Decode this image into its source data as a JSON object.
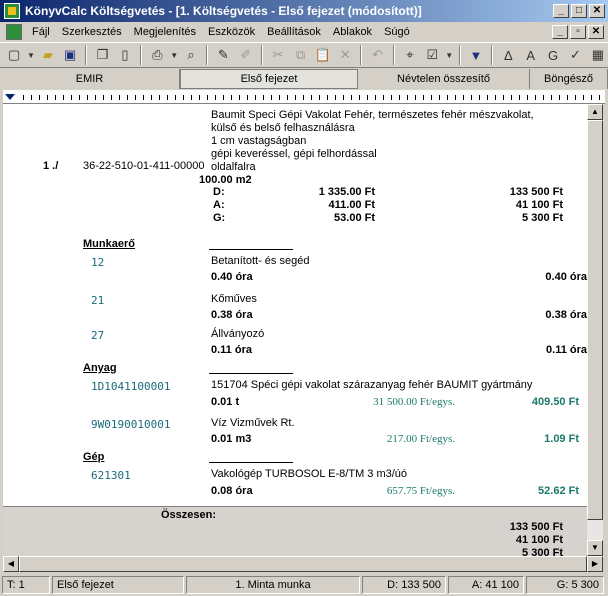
{
  "window": {
    "title": "KönyvCalc Költségvetés - [1. Költségvetés - Első fejezet (módosított)]",
    "buttons": [
      "_",
      "□",
      "✕"
    ]
  },
  "menu": {
    "items": [
      "Fájl",
      "Szerkesztés",
      "Megjelenítés",
      "Eszközök",
      "Beállítások",
      "Ablakok",
      "Súgó"
    ]
  },
  "tabs": [
    "EMIR",
    "Első fejezet",
    "Névtelen összesítő",
    "Böngésző"
  ],
  "item": {
    "number": "1 ./",
    "code": "36-22-510-01-411-00000",
    "description": [
      "Baumit Speci Gépi Vakolat Fehér, természetes fehér mészvakolat,",
      "külső és belső felhasználásra",
      "1 cm vastagságban",
      "gépi keveréssel, gépi felhordással",
      "oldalfalra"
    ],
    "quantity": "100.00 m2",
    "rows": [
      {
        "label": "D:",
        "unit_price": "1 335.00 Ft",
        "total": "133 500 Ft"
      },
      {
        "label": "A:",
        "unit_price": "411.00 Ft",
        "total": "41 100 Ft"
      },
      {
        "label": "G:",
        "unit_price": "53.00 Ft",
        "total": "5 300 Ft"
      }
    ]
  },
  "sections": {
    "labor": {
      "title": "Munkaerő",
      "rows": [
        {
          "code": "12",
          "name": "Betanított- és segéd",
          "qty": "0.40 óra",
          "amount": "0.40 óra"
        },
        {
          "code": "21",
          "name": "Kőműves",
          "qty": "0.38 óra",
          "amount": "0.38 óra"
        },
        {
          "code": "27",
          "name": "Állványozó",
          "qty": "0.11 óra",
          "amount": "0.11 óra"
        }
      ]
    },
    "material": {
      "title": "Anyag",
      "rows": [
        {
          "code": "1D1041100001",
          "name": "151704 Spéci gépi vakolat szárazanyag fehér BAUMIT gyártmány",
          "qty": "0.01 t",
          "price": "31 500.00 Ft/egys.",
          "amount": "409.50 Ft"
        },
        {
          "code": "9W0190010001",
          "name": "Víz Vizművek Rt.",
          "qty": "0.01 m3",
          "price": "217.00 Ft/egys.",
          "amount": "1.09 Ft"
        }
      ]
    },
    "machine": {
      "title": "Gép",
      "rows": [
        {
          "code": "621301",
          "name": "Vakológép TURBOSOL E-8/TM 3 m3/úó",
          "qty": "0.08 óra",
          "price": "657.75 Ft/egys.",
          "amount": "52.62 Ft"
        }
      ]
    }
  },
  "totals": {
    "label": "Összesen:",
    "values": [
      "133 500 Ft",
      "41 100 Ft",
      "5 300 Ft"
    ]
  },
  "status": {
    "t": "T: 1",
    "chapter": "Első fejezet",
    "project": "1. Minta munka",
    "d": "D: 133 500",
    "a": "A: 41 100",
    "g": "G: 5 300"
  }
}
